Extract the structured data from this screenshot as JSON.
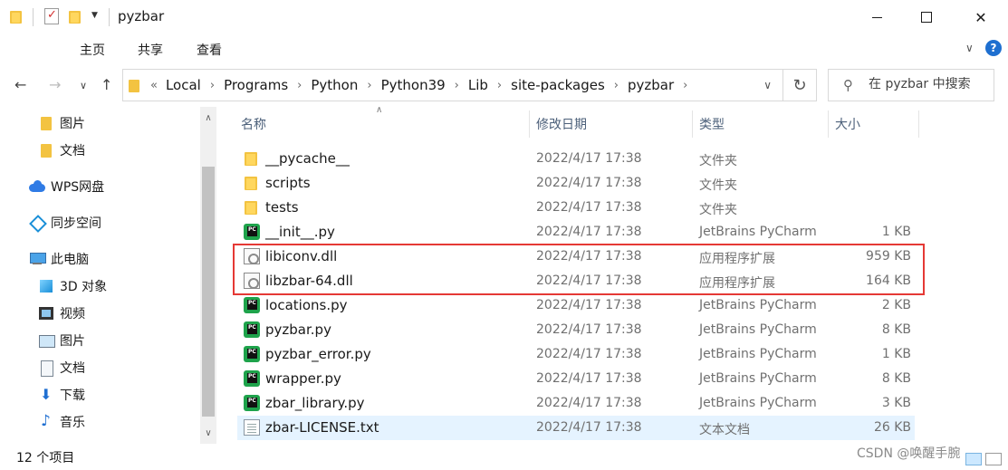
{
  "window": {
    "title": "pyzbar"
  },
  "ribbon": {
    "tabs": [
      "主页",
      "共享",
      "查看"
    ]
  },
  "address": {
    "lead": "«",
    "crumbs": [
      "Local",
      "Programs",
      "Python",
      "Python39",
      "Lib",
      "site-packages",
      "pyzbar"
    ]
  },
  "search": {
    "placeholder": "在 pyzbar 中搜索"
  },
  "sidebar": {
    "items": [
      {
        "label": "图片",
        "icon": "folder-icon"
      },
      {
        "label": "文档",
        "icon": "folder-icon"
      },
      {
        "label": "WPS网盘",
        "icon": "cloud-icon"
      },
      {
        "label": "同步空间",
        "icon": "sync-icon"
      },
      {
        "label": "此电脑",
        "icon": "computer-icon"
      },
      {
        "label": "3D 对象",
        "icon": "3d-objects-icon"
      },
      {
        "label": "视频",
        "icon": "video-icon"
      },
      {
        "label": "图片",
        "icon": "pictures-icon"
      },
      {
        "label": "文档",
        "icon": "documents-icon"
      },
      {
        "label": "下载",
        "icon": "download-icon"
      },
      {
        "label": "音乐",
        "icon": "music-icon"
      }
    ]
  },
  "columns": {
    "name": "名称",
    "date": "修改日期",
    "type": "类型",
    "size": "大小"
  },
  "files": [
    {
      "name": "__pycache__",
      "date": "2022/4/17 17:38",
      "type": "文件夹",
      "size": "",
      "icon": "folder-icon"
    },
    {
      "name": "scripts",
      "date": "2022/4/17 17:38",
      "type": "文件夹",
      "size": "",
      "icon": "folder-icon"
    },
    {
      "name": "tests",
      "date": "2022/4/17 17:38",
      "type": "文件夹",
      "size": "",
      "icon": "folder-icon"
    },
    {
      "name": "__init__.py",
      "date": "2022/4/17 17:38",
      "type": "JetBrains PyCharm",
      "size": "1 KB",
      "icon": "pycharm-file-icon"
    },
    {
      "name": "libiconv.dll",
      "date": "2022/4/17 17:38",
      "type": "应用程序扩展",
      "size": "959 KB",
      "icon": "dll-file-icon"
    },
    {
      "name": "libzbar-64.dll",
      "date": "2022/4/17 17:38",
      "type": "应用程序扩展",
      "size": "164 KB",
      "icon": "dll-file-icon"
    },
    {
      "name": "locations.py",
      "date": "2022/4/17 17:38",
      "type": "JetBrains PyCharm",
      "size": "2 KB",
      "icon": "pycharm-file-icon"
    },
    {
      "name": "pyzbar.py",
      "date": "2022/4/17 17:38",
      "type": "JetBrains PyCharm",
      "size": "8 KB",
      "icon": "pycharm-file-icon"
    },
    {
      "name": "pyzbar_error.py",
      "date": "2022/4/17 17:38",
      "type": "JetBrains PyCharm",
      "size": "1 KB",
      "icon": "pycharm-file-icon"
    },
    {
      "name": "wrapper.py",
      "date": "2022/4/17 17:38",
      "type": "JetBrains PyCharm",
      "size": "8 KB",
      "icon": "pycharm-file-icon"
    },
    {
      "name": "zbar_library.py",
      "date": "2022/4/17 17:38",
      "type": "JetBrains PyCharm",
      "size": "3 KB",
      "icon": "pycharm-file-icon"
    },
    {
      "name": "zbar-LICENSE.txt",
      "date": "2022/4/17 17:38",
      "type": "文本文档",
      "size": "26 KB",
      "icon": "text-file-icon",
      "selected": true
    }
  ],
  "status": {
    "count": "12 个项目"
  },
  "watermark": "CSDN @唤醒手腕",
  "colors": {
    "highlight_border": "#e53935",
    "selection": "#e5f3ff",
    "folder": "#f3c341"
  }
}
